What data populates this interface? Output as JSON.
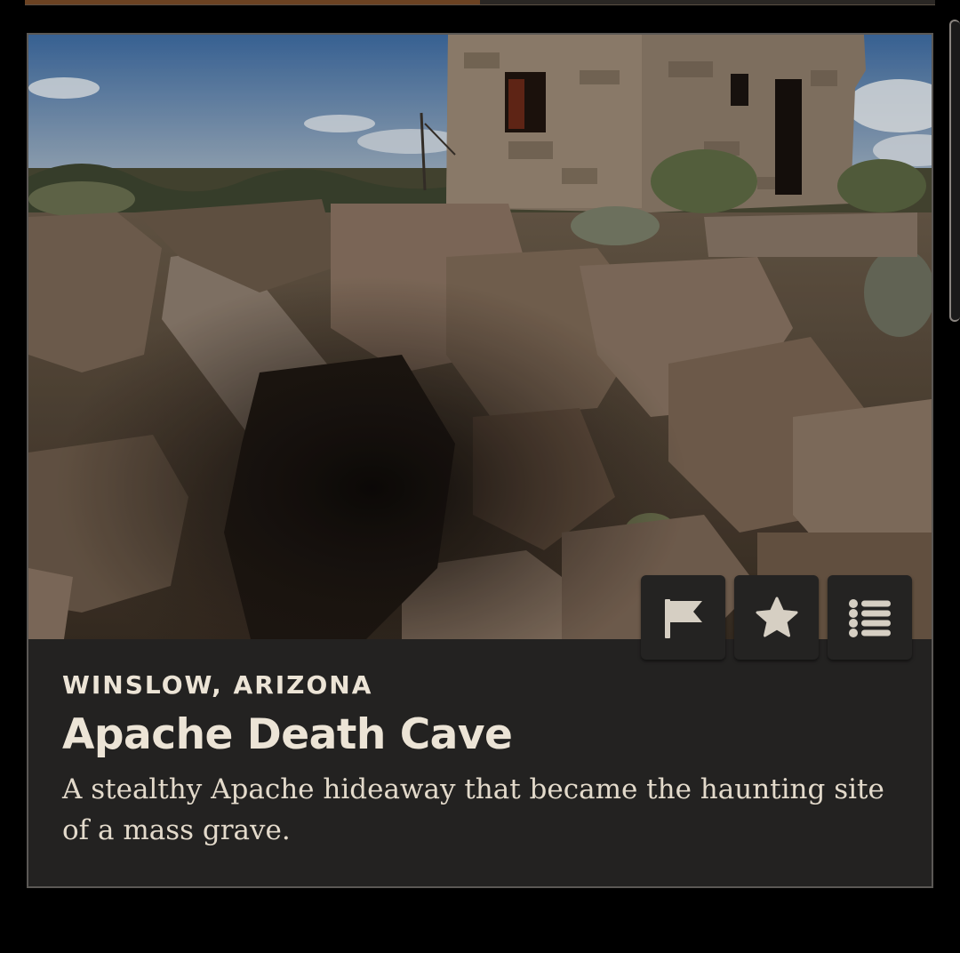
{
  "progress": {
    "fraction": 0.5
  },
  "place": {
    "location": "WINSLOW, ARIZONA",
    "title": "Apache Death Cave",
    "description": "A stealthy Apache hideaway that became the haunting site of a mass grave."
  },
  "photo": {
    "subject": "rocky cave opening with ruined stone building"
  },
  "actions": [
    {
      "name": "flag",
      "icon": "flag-icon"
    },
    {
      "name": "favorite",
      "icon": "star-icon"
    },
    {
      "name": "list",
      "icon": "list-icon"
    }
  ],
  "colors": {
    "background": "#000000",
    "card": "#232221",
    "text": "#ece4d6",
    "icon": "#d6cfc3",
    "progress": "#6b4222"
  }
}
